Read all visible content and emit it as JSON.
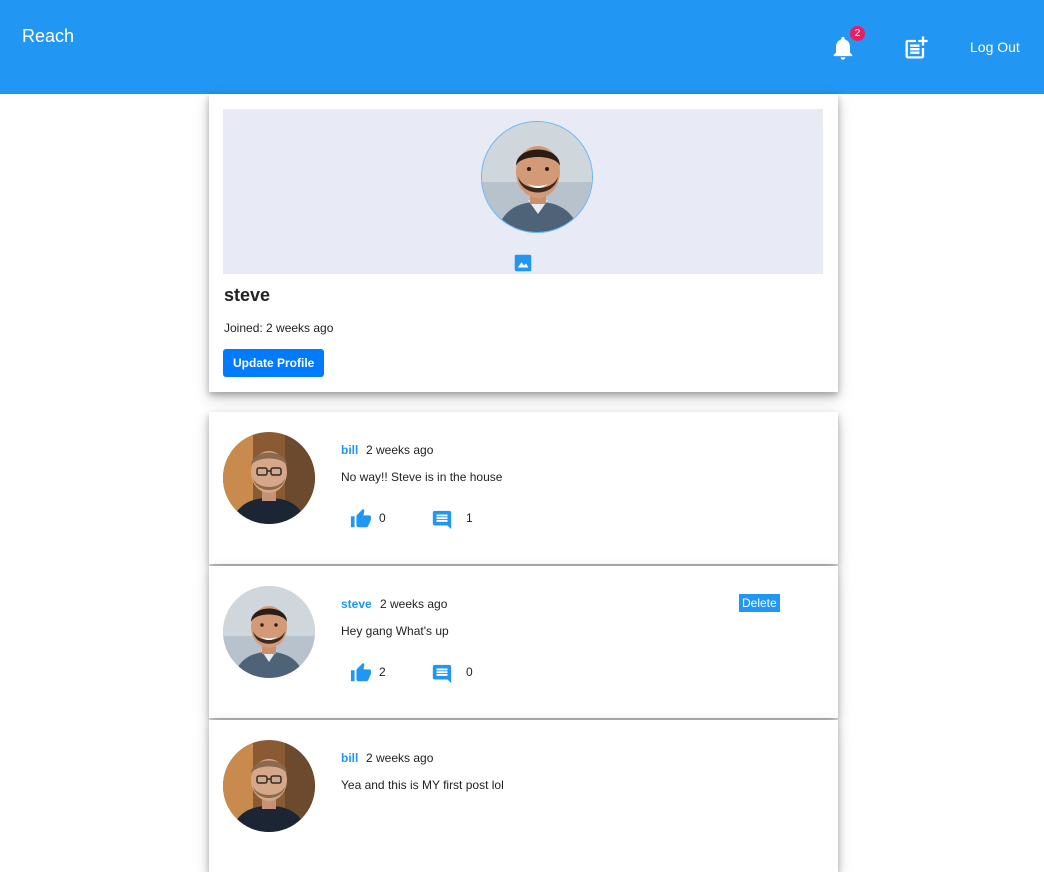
{
  "appbar": {
    "brand": "Reach",
    "notification_count": "2",
    "logout_label": "Log Out"
  },
  "profile": {
    "handle": "steve",
    "joined": "Joined: 2 weeks ago",
    "update_label": "Update Profile"
  },
  "posts": [
    {
      "author": "bill",
      "time": "2 weeks ago",
      "body": "No way!! Steve is in the house",
      "likes": "0",
      "comments": "1"
    },
    {
      "author": "steve",
      "time": "2 weeks ago",
      "body": "Hey gang What's up",
      "likes": "2",
      "comments": "0",
      "delete_label": "Delete"
    },
    {
      "author": "bill",
      "time": "2 weeks ago",
      "body": "Yea and this is MY first post lol"
    }
  ],
  "colors": {
    "appbar": "#2196f3",
    "badge": "#e91e63",
    "button": "#007bff",
    "cover": "#e8eaf6"
  }
}
